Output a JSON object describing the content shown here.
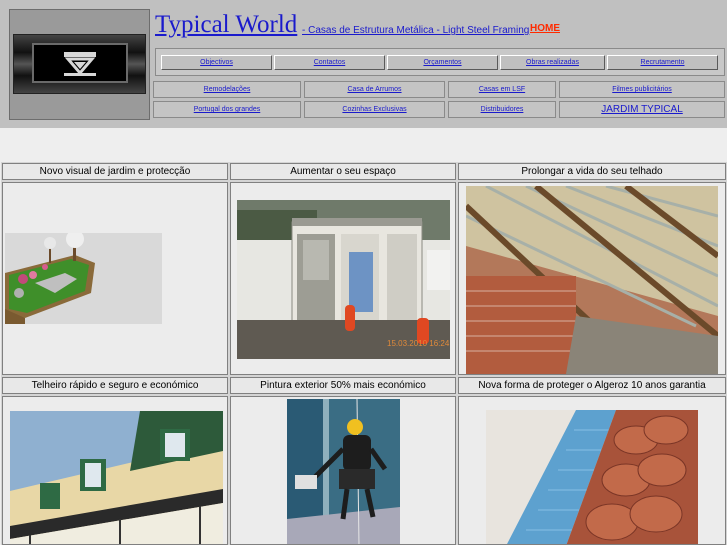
{
  "header": {
    "title": "Typical World",
    "subtitle": "- Casas de Estrutura Metálica - Light Steel Framing",
    "home_label": "HOME"
  },
  "nav_primary": [
    {
      "label": "Objectivos"
    },
    {
      "label": "Contactos"
    },
    {
      "label": "Orçamentos"
    },
    {
      "label": "Obras realizadas"
    },
    {
      "label": "Recrutamento"
    }
  ],
  "nav_secondary": [
    {
      "label": "Remodelações"
    },
    {
      "label": "Casa de Arrumos"
    },
    {
      "label": "Casas em LSF"
    },
    {
      "label": "Filmes publicitários"
    },
    {
      "label": "Portugal dos grandes"
    },
    {
      "label": "Cozinhas Exclusivas"
    },
    {
      "label": "Distribuidores"
    },
    {
      "label": "JARDIM TYPICAL"
    }
  ],
  "gallery": [
    {
      "caption": "Novo visual de jardim e protecção",
      "image": "garden-render"
    },
    {
      "caption": "Aumentar o seu espaço",
      "image": "storage-cabin",
      "photo_stamp": "15.03.2010 16:24"
    },
    {
      "caption": "Prolongar a vida do seu telhado",
      "image": "roof-interior"
    },
    {
      "caption": "Telheiro rápido e seguro e económico",
      "image": "house-canopy"
    },
    {
      "caption": "Pintura exterior 50% mais económico",
      "image": "rope-access-painter"
    },
    {
      "caption": "Nova forma de proteger o Algeroz 10 anos garantia",
      "image": "gutter-protection"
    }
  ],
  "colors": {
    "link": "#1a1acc",
    "home": "#ff2a00",
    "header_bg": "#c0c0c0",
    "page_bg": "#eeeeee"
  }
}
